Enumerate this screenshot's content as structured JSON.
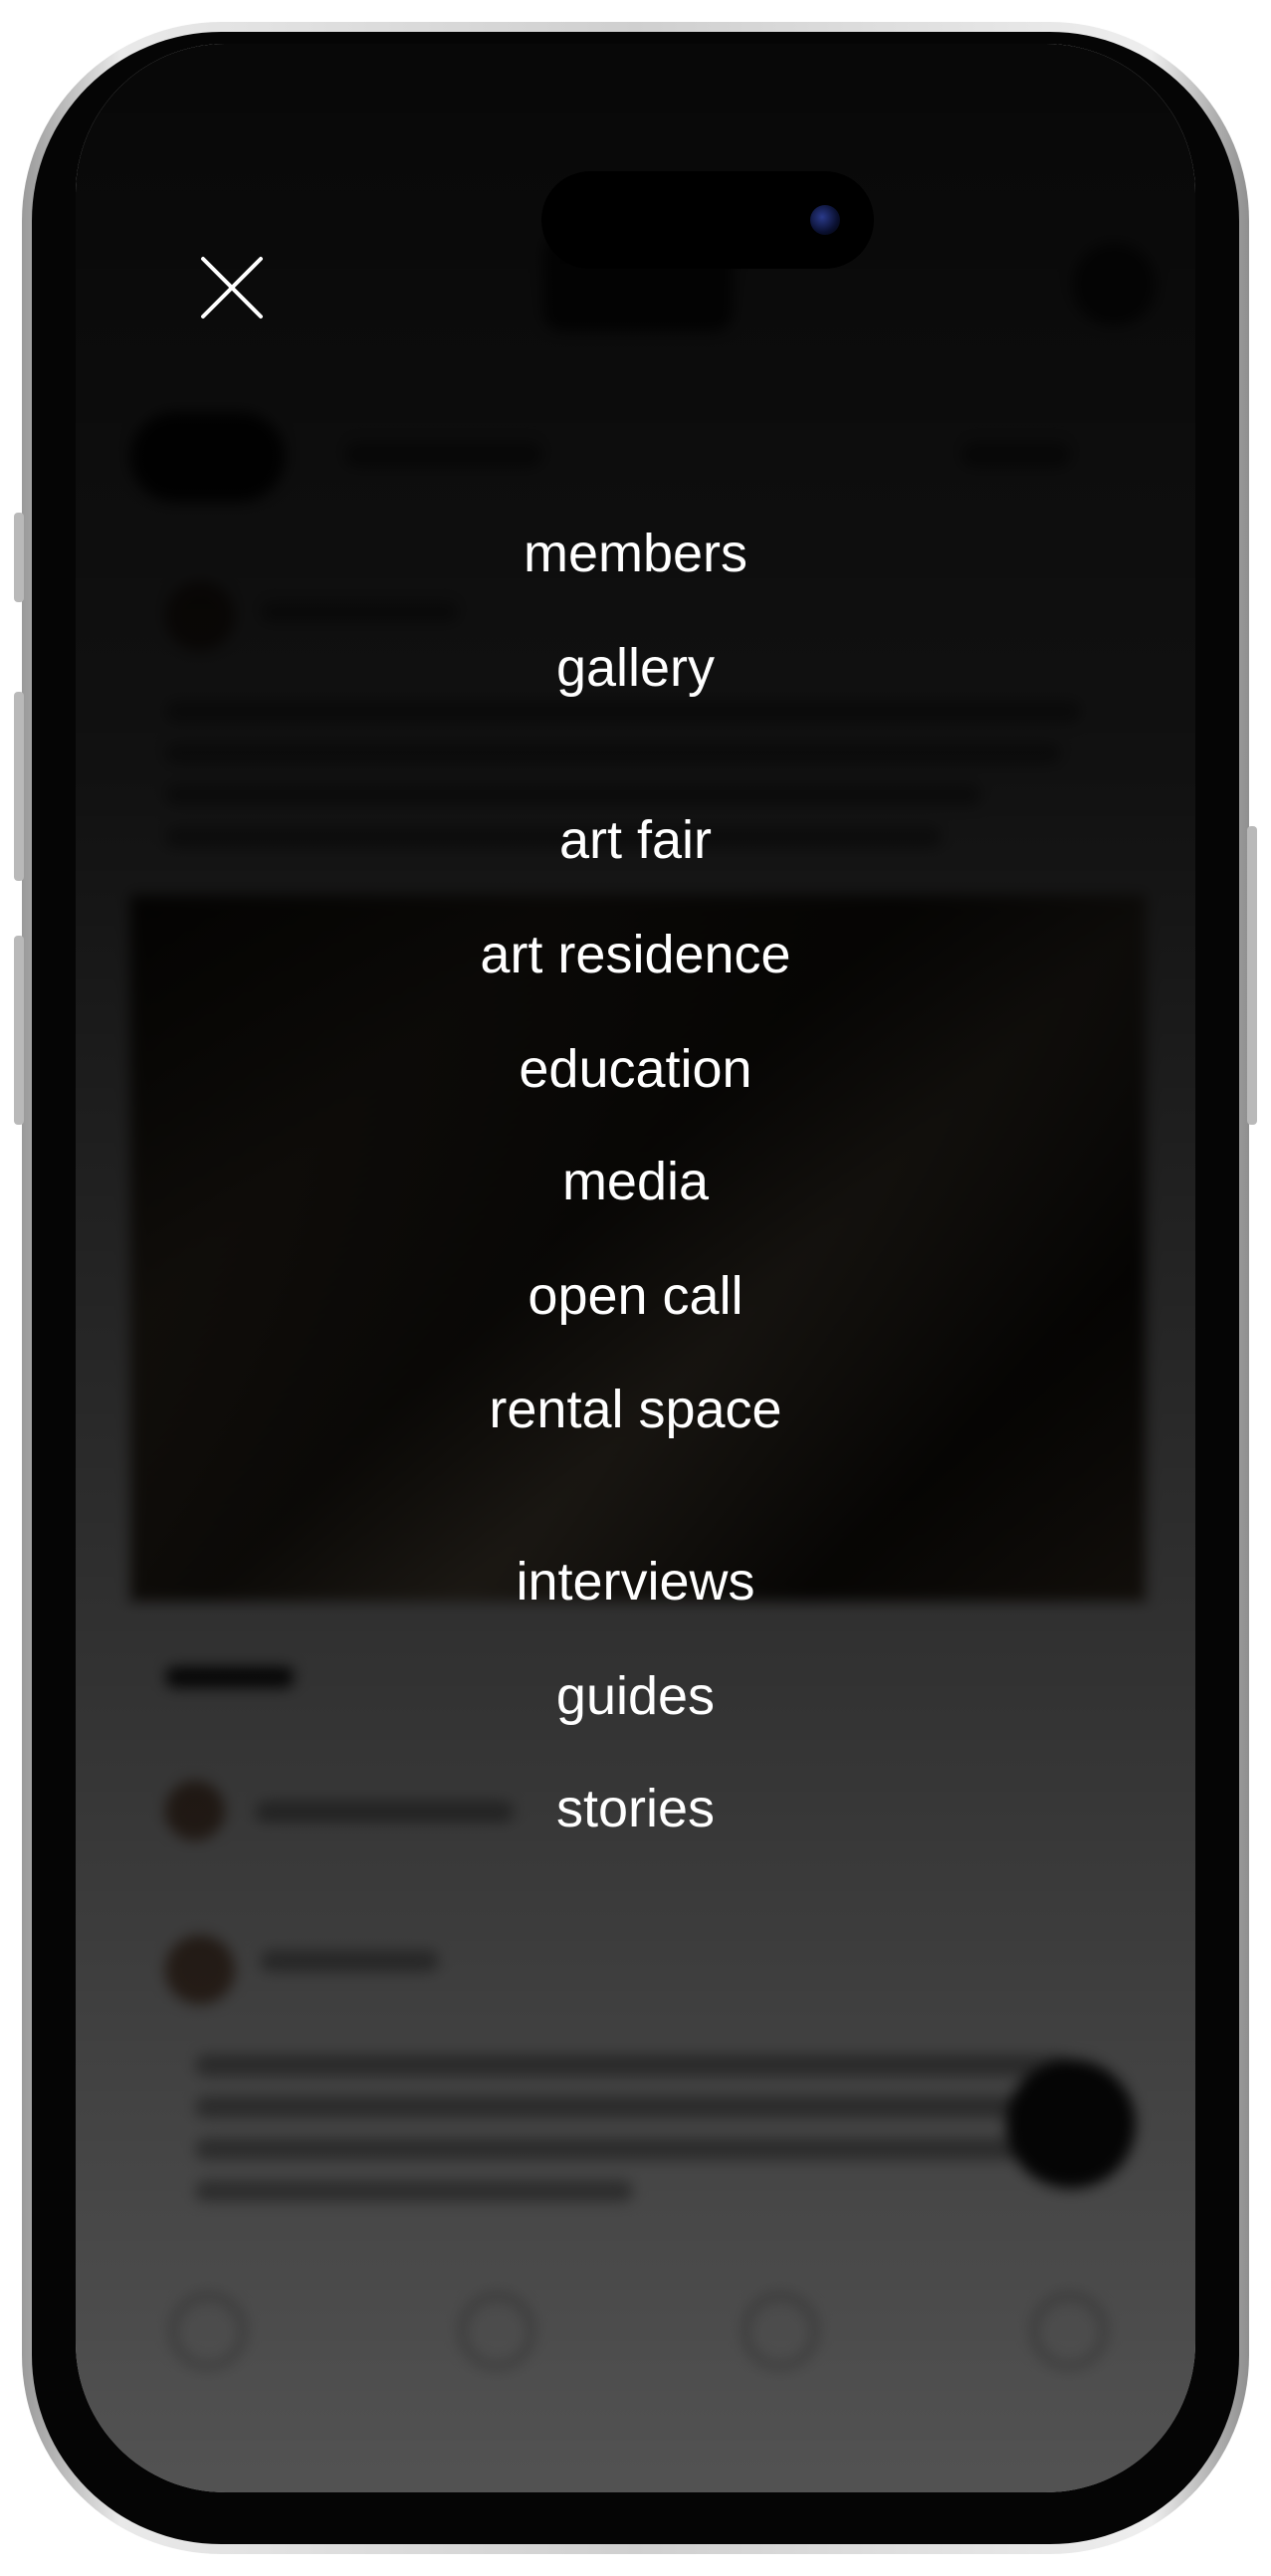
{
  "menu": {
    "close_icon": "close-icon",
    "group_primary": [
      {
        "label": "members"
      },
      {
        "label": "gallery"
      }
    ],
    "group_secondary": [
      {
        "label": "art fair"
      },
      {
        "label": "art residence"
      },
      {
        "label": "education"
      },
      {
        "label": "media"
      },
      {
        "label": "open call"
      },
      {
        "label": "rental space"
      }
    ],
    "group_content": [
      {
        "label": "interviews"
      },
      {
        "label": "guides"
      },
      {
        "label": "stories"
      }
    ]
  },
  "colors": {
    "overlay": "#000000",
    "menu_text": "#ffffff",
    "camera": "#2a3a8a"
  }
}
